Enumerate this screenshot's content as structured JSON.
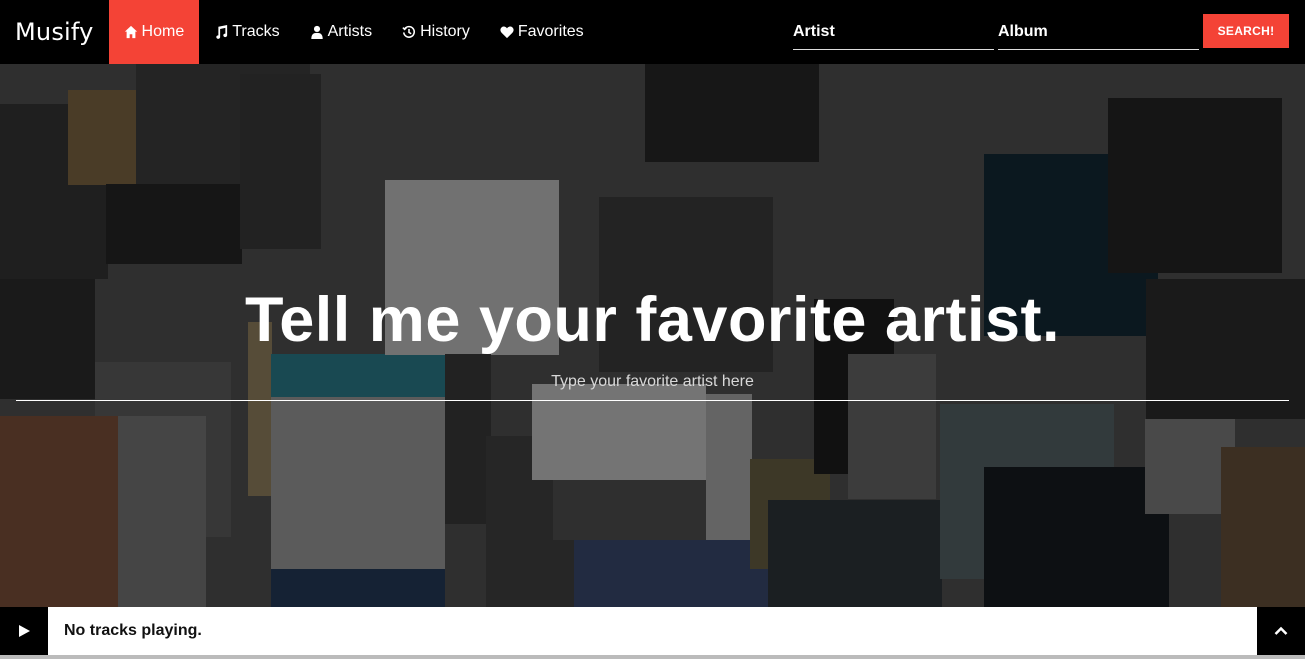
{
  "brand": "Musify",
  "nav": [
    {
      "label": "Home",
      "icon": "home-icon",
      "active": true
    },
    {
      "label": "Tracks",
      "icon": "music-note-icon",
      "active": false
    },
    {
      "label": "Artists",
      "icon": "user-icon",
      "active": false
    },
    {
      "label": "History",
      "icon": "history-icon",
      "active": false
    },
    {
      "label": "Favorites",
      "icon": "heart-icon",
      "active": false
    }
  ],
  "search": {
    "artist_placeholder": "Artist",
    "album_placeholder": "Album",
    "button_label": "SEARCH!"
  },
  "hero": {
    "title": "Tell me your favorite artist.",
    "input_placeholder": "Type your favorite artist here"
  },
  "player": {
    "status": "No tracks playing."
  },
  "colors": {
    "accent": "#f44336",
    "navbar": "#000000",
    "player": "#ffffff"
  }
}
